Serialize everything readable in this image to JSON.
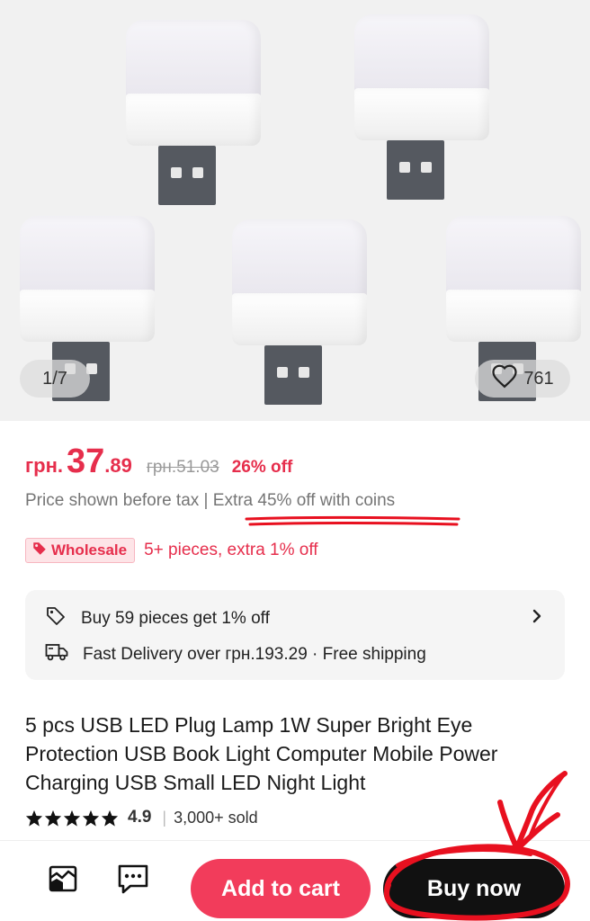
{
  "gallery": {
    "counter": "1/7",
    "likes": "761"
  },
  "price": {
    "currency": "грн.",
    "main": "37",
    "cents": ".89",
    "old": "грн.51.03",
    "discount": "26% off"
  },
  "tax_note": {
    "prefix": "Price shown before tax | ",
    "coins": "Extra 45% off with coins"
  },
  "wholesale": {
    "badge": "Wholesale",
    "text": "5+ pieces, extra 1% off"
  },
  "info": {
    "bulk": "Buy 59 pieces get 1% off",
    "delivery": "Fast Delivery over грн.193.29",
    "shipping": " · Free shipping"
  },
  "product": {
    "title": "5 pcs USB LED Plug Lamp 1W Super Bright Eye Protection USB Book Light Computer Mobile Power Charging USB Small LED Night Light",
    "rating": "4.9",
    "rating_stars": 5,
    "sold": "3,000+ sold"
  },
  "actions": {
    "add_to_cart": "Add to cart",
    "buy_now": "Buy now"
  },
  "icons": {
    "store": "store-icon",
    "chat": "chat-icon",
    "heart": "heart-icon",
    "tag": "tag-icon",
    "truck": "truck-icon",
    "chevron": "chevron-right-icon"
  },
  "colors": {
    "accent": "#e62e4c",
    "add_to_cart_bg": "#f23c5b",
    "buy_now_bg": "#111111",
    "annotation": "#e8101f"
  }
}
